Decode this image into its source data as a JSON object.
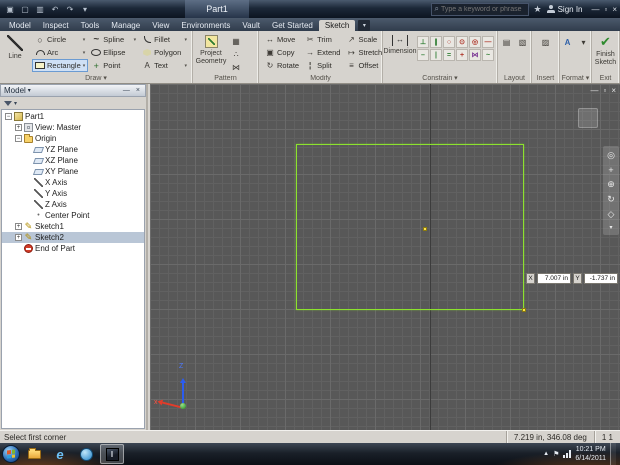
{
  "titlebar": {
    "title": "Part1",
    "search_placeholder": "Type a keyword or phrase",
    "sign_in": "Sign In"
  },
  "menu": {
    "tabs": [
      "Model",
      "Inspect",
      "Tools",
      "Manage",
      "View",
      "Environments",
      "Vault",
      "Get Started",
      "Sketch"
    ],
    "active_tab": "Sketch"
  },
  "ribbon": {
    "draw": {
      "primary": "Line",
      "tools": [
        {
          "label": "Circle",
          "dd": true
        },
        {
          "label": "Arc",
          "dd": true
        },
        {
          "label": "Rectangle",
          "dd": true,
          "active": true
        },
        {
          "label": "Spline",
          "dd": true
        },
        {
          "label": "Ellipse"
        },
        {
          "label": "Point"
        },
        {
          "label": "Fillet",
          "dd": true
        },
        {
          "label": "Polygon"
        },
        {
          "label": "Text",
          "dd": true
        }
      ],
      "panel_label": "Draw ▾"
    },
    "pattern": {
      "project_geometry": "Project Geometry",
      "panel_label": "Pattern"
    },
    "modify": {
      "tools": [
        "Move",
        "Copy",
        "Rotate",
        "Trim",
        "Extend",
        "Split",
        "Scale",
        "Stretch",
        "Offset"
      ],
      "panel_label": "Modify"
    },
    "constrain": {
      "dimension": "Dimension",
      "icons": [
        "perpendicular",
        "parallel",
        "tangent",
        "coincident",
        "concentric",
        "collinear",
        "horizontal",
        "vertical",
        "equal",
        "fix",
        "symmetric",
        "smooth"
      ],
      "panel_label": "Constrain ▾"
    },
    "layout": {
      "panel_label": "Layout"
    },
    "insert": {
      "panel_label": "Insert"
    },
    "format": {
      "panel_label": "Format ▾"
    },
    "exit": {
      "finish": "Finish Sketch",
      "panel_label": "Exit"
    }
  },
  "browser": {
    "header": "Model",
    "tree": [
      {
        "label": "Part1",
        "icon": "part-icon",
        "depth": 0,
        "expander": true,
        "expanded": true
      },
      {
        "label": "View: Master",
        "icon": "view-icon",
        "depth": 1,
        "expander": true
      },
      {
        "label": "Origin",
        "icon": "folder-icon",
        "depth": 1,
        "expander": true,
        "expanded": true
      },
      {
        "label": "YZ Plane",
        "icon": "plane-icon",
        "depth": 2
      },
      {
        "label": "XZ Plane",
        "icon": "plane-icon",
        "depth": 2
      },
      {
        "label": "XY Plane",
        "icon": "plane-icon",
        "depth": 2
      },
      {
        "label": "X Axis",
        "icon": "axis-icon",
        "depth": 2
      },
      {
        "label": "Y Axis",
        "icon": "axis-icon",
        "depth": 2
      },
      {
        "label": "Z Axis",
        "icon": "axis-icon",
        "depth": 2
      },
      {
        "label": "Center Point",
        "icon": "point-icon",
        "depth": 2
      },
      {
        "label": "Sketch1",
        "icon": "sketch-icon",
        "depth": 1,
        "expander": true
      },
      {
        "label": "Sketch2",
        "icon": "sketch-icon",
        "depth": 1,
        "expander": true,
        "selected": true
      },
      {
        "label": "End of Part",
        "icon": "end-icon",
        "depth": 1
      }
    ]
  },
  "canvas": {
    "coords": {
      "x_label": "X",
      "x_value": "7.007 in",
      "y_label": "Y",
      "y_value": "-1.737 in"
    },
    "triad": {
      "x": "x",
      "z": "Z"
    }
  },
  "status": {
    "prompt": "Select first corner",
    "readout": "7.219 in, 346.08 deg",
    "counter": "1 1"
  },
  "taskbar": {
    "time": "10:21 PM",
    "date": "6/14/2011"
  }
}
